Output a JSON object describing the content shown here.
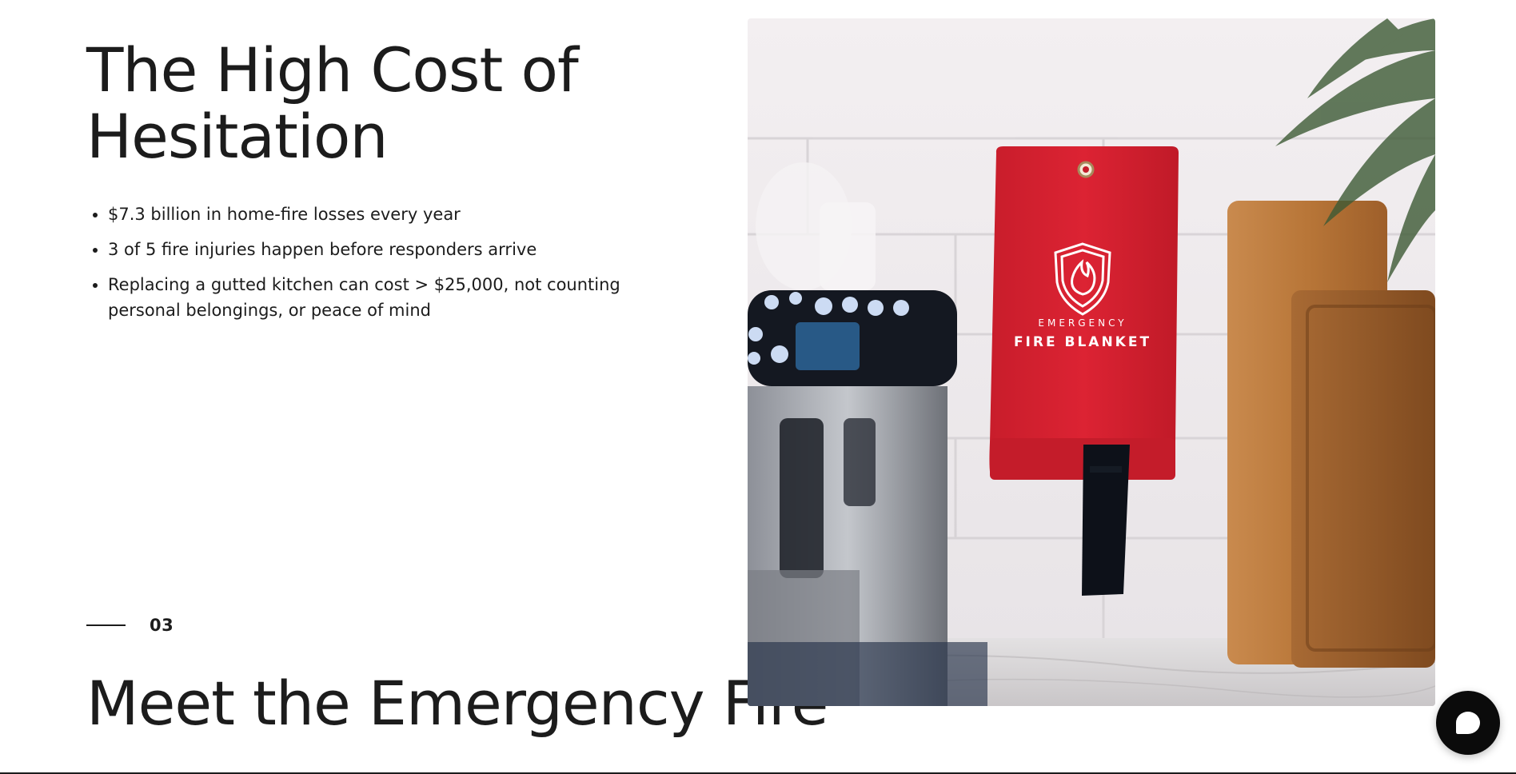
{
  "section": {
    "heading": "The High Cost of Hesitation",
    "bullets": [
      "$7.3 billion in home-fire losses every year",
      "3 of 5 fire injuries happen before responders arrive",
      "Replacing a gutted kitchen can cost > $25,000, not counting personal belongings, or peace of mind"
    ]
  },
  "next_section": {
    "number": "03",
    "heading": "Meet the Emergency Fire"
  },
  "product_image": {
    "label_small": "EMERGENCY",
    "label_large": "FIRE BLANKET",
    "blanket_color": "#d4212f"
  },
  "chat": {
    "icon": "chat-bubble-icon"
  }
}
